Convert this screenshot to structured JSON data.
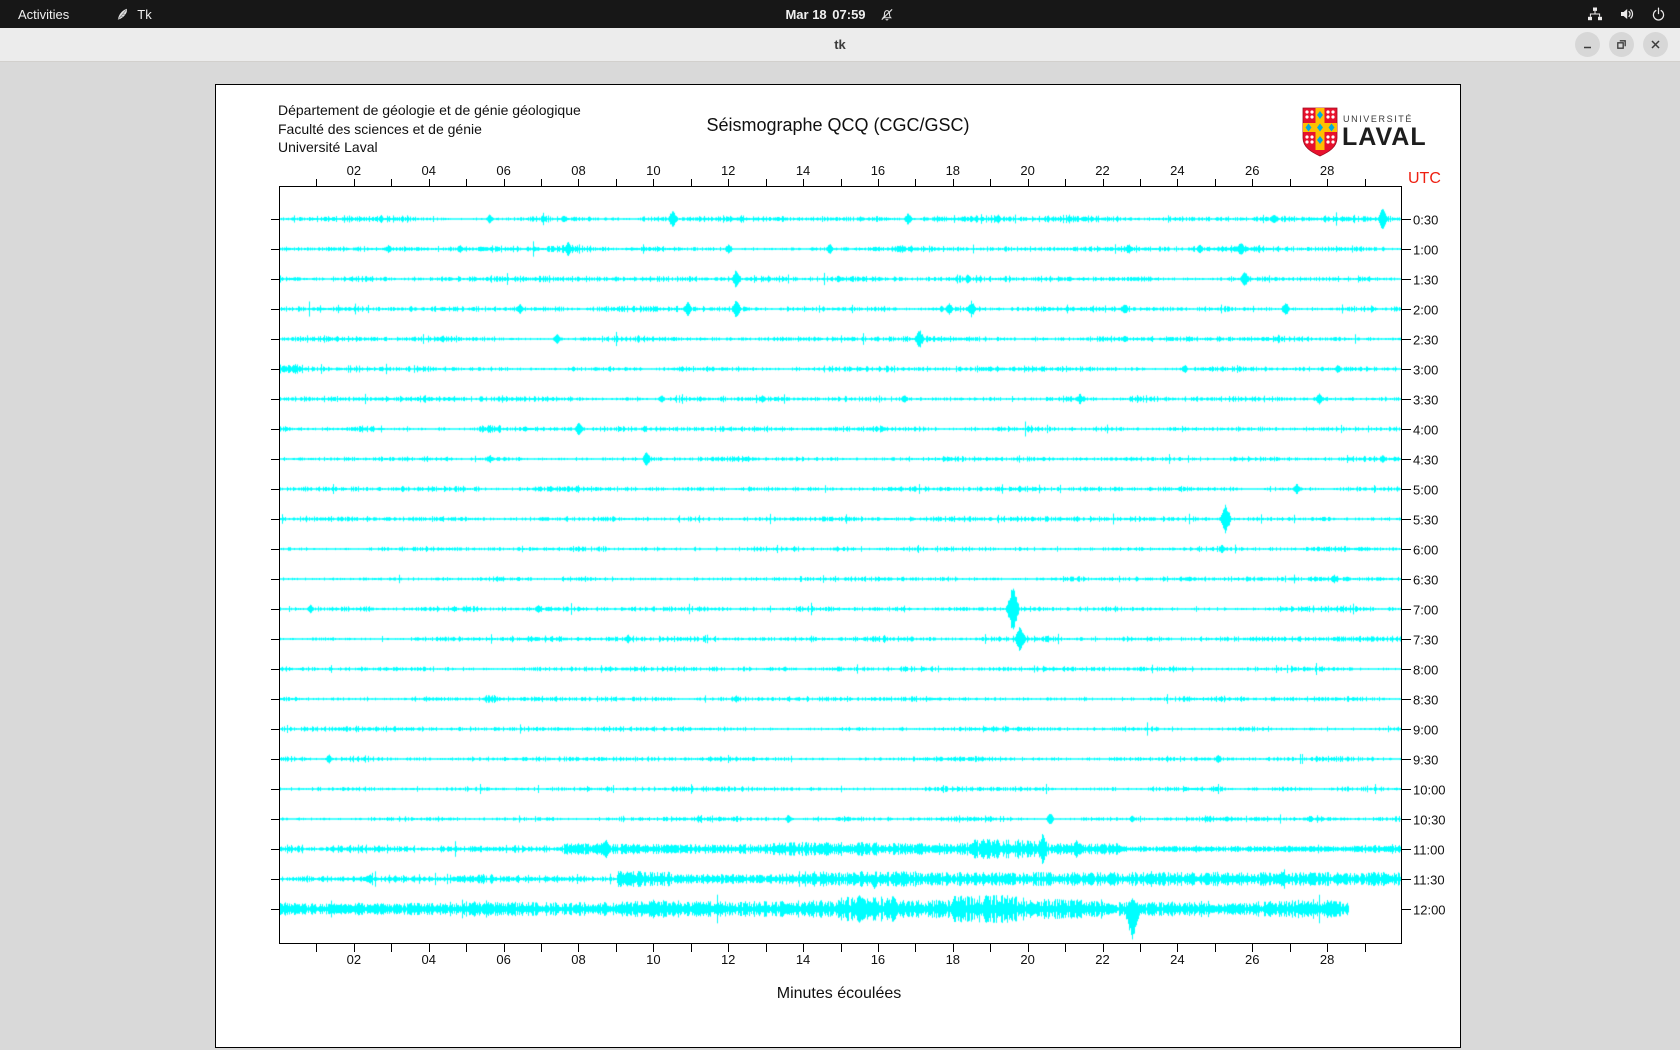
{
  "topbar": {
    "activities": "Activities",
    "app_name": "Tk",
    "clock_date": "Mar 18",
    "clock_time": "07:59"
  },
  "titlebar": {
    "title": "tk"
  },
  "header": {
    "line1": "Département de géologie et de génie géologique",
    "line2": "Faculté des sciences et de génie",
    "line3": "Université Laval",
    "title": "Séismographe QCQ (CGC/GSC)"
  },
  "logo": {
    "small": "UNIVERSITÉ",
    "large": "LAVAL"
  },
  "axis": {
    "utc_label": "UTC",
    "xlabel": "Minutes écoulées",
    "x_tick_labels": [
      "02",
      "04",
      "06",
      "08",
      "10",
      "12",
      "14",
      "16",
      "18",
      "20",
      "22",
      "24",
      "26",
      "28"
    ],
    "x_tick_minutes": [
      2,
      4,
      6,
      8,
      10,
      12,
      14,
      16,
      18,
      20,
      22,
      24,
      26,
      28
    ],
    "x_minor_step": 1,
    "y_labels": [
      "0:30",
      "1:00",
      "1:30",
      "2:00",
      "2:30",
      "3:00",
      "3:30",
      "4:00",
      "4:30",
      "5:00",
      "5:30",
      "6:00",
      "6:30",
      "7:00",
      "7:30",
      "8:00",
      "8:30",
      "9:00",
      "9:30",
      "10:00",
      "10:30",
      "11:00",
      "11:30",
      "12:00"
    ]
  },
  "colors": {
    "trace": "#00ffff",
    "utc_red": "#ee2012",
    "shield_red": "#e8112d",
    "shield_gold": "#ffbf00",
    "shield_blue": "#00a9e0"
  },
  "chart_data": {
    "type": "line",
    "subtype": "seismogram-helicorder",
    "title": "Séismographe QCQ (CGC/GSC)",
    "xlabel": "Minutes écoulées",
    "x_range_minutes": [
      0,
      30
    ],
    "row_interval_minutes": 30,
    "timezone_label": "UTC",
    "rows": [
      {
        "label": "0:30",
        "base": 1.8,
        "end": 30,
        "bursts": [],
        "spikes": [
          [
            5.6,
            5
          ],
          [
            10.5,
            10
          ],
          [
            16.8,
            7
          ],
          [
            19.2,
            5
          ],
          [
            26.6,
            6
          ],
          [
            29.5,
            12
          ]
        ]
      },
      {
        "label": "1:00",
        "base": 1.8,
        "end": 30,
        "bursts": [],
        "spikes": [
          [
            2.9,
            5
          ],
          [
            4.8,
            5
          ],
          [
            7.7,
            8
          ],
          [
            12.0,
            6
          ],
          [
            14.7,
            6
          ],
          [
            22.7,
            6
          ],
          [
            24.6,
            5
          ],
          [
            25.7,
            8
          ]
        ]
      },
      {
        "label": "1:30",
        "base": 1.6,
        "end": 30,
        "bursts": [],
        "spikes": [
          [
            12.2,
            10
          ],
          [
            18.4,
            5
          ],
          [
            25.8,
            9
          ]
        ]
      },
      {
        "label": "2:00",
        "base": 1.7,
        "end": 30,
        "bursts": [],
        "spikes": [
          [
            6.4,
            6
          ],
          [
            10.9,
            8
          ],
          [
            12.2,
            11
          ],
          [
            17.9,
            7
          ],
          [
            18.5,
            9
          ],
          [
            22.6,
            6
          ],
          [
            26.9,
            8
          ]
        ]
      },
      {
        "label": "2:30",
        "base": 1.7,
        "end": 30,
        "bursts": [],
        "spikes": [
          [
            7.4,
            6
          ],
          [
            17.1,
            11
          ],
          [
            22.6,
            5
          ]
        ]
      },
      {
        "label": "3:00",
        "base": 1.7,
        "end": 30,
        "bursts": [
          [
            0,
            0.6,
            5
          ]
        ],
        "spikes": [
          [
            24.2,
            5
          ],
          [
            28.3,
            5
          ]
        ]
      },
      {
        "label": "3:30",
        "base": 1.6,
        "end": 30,
        "bursts": [],
        "spikes": [
          [
            10.2,
            5
          ],
          [
            12.9,
            5
          ],
          [
            16.7,
            5
          ],
          [
            21.4,
            6
          ],
          [
            27.8,
            7
          ]
        ]
      },
      {
        "label": "4:00",
        "base": 1.6,
        "end": 30,
        "bursts": [
          [
            5.3,
            5.9,
            4
          ]
        ],
        "spikes": [
          [
            8.0,
            8
          ]
        ]
      },
      {
        "label": "4:30",
        "base": 1.6,
        "end": 30,
        "bursts": [],
        "spikes": [
          [
            5.6,
            5
          ],
          [
            9.8,
            8
          ],
          [
            29.5,
            5
          ]
        ]
      },
      {
        "label": "5:00",
        "base": 1.5,
        "end": 30,
        "bursts": [],
        "spikes": [
          [
            27.2,
            6
          ]
        ]
      },
      {
        "label": "5:30",
        "base": 1.5,
        "end": 30,
        "bursts": [],
        "spikes": [
          [
            25.3,
            16
          ]
        ]
      },
      {
        "label": "6:00",
        "base": 1.4,
        "end": 30,
        "bursts": [],
        "spikes": [
          [
            25.2,
            5
          ]
        ]
      },
      {
        "label": "6:30",
        "base": 1.5,
        "end": 30,
        "bursts": [],
        "spikes": [
          [
            28.2,
            5
          ]
        ]
      },
      {
        "label": "7:00",
        "base": 1.6,
        "end": 30,
        "bursts": [],
        "spikes": [
          [
            0.8,
            5
          ],
          [
            6.9,
            5
          ],
          [
            19.6,
            24
          ]
        ]
      },
      {
        "label": "7:30",
        "base": 1.6,
        "end": 30,
        "bursts": [],
        "spikes": [
          [
            9.3,
            5
          ],
          [
            19.8,
            15
          ]
        ]
      },
      {
        "label": "8:00",
        "base": 1.4,
        "end": 30,
        "bursts": [],
        "spikes": [
          [
            13.5,
            3
          ]
        ]
      },
      {
        "label": "8:30",
        "base": 1.5,
        "end": 30,
        "bursts": [
          [
            5.4,
            5.8,
            4
          ]
        ],
        "spikes": [
          [
            12.2,
            4
          ]
        ]
      },
      {
        "label": "9:00",
        "base": 1.4,
        "end": 30,
        "bursts": [],
        "spikes": []
      },
      {
        "label": "9:30",
        "base": 1.5,
        "end": 30,
        "bursts": [],
        "spikes": [
          [
            1.3,
            5
          ],
          [
            25.1,
            5
          ]
        ]
      },
      {
        "label": "10:00",
        "base": 1.4,
        "end": 30,
        "bursts": [],
        "spikes": []
      },
      {
        "label": "10:30",
        "base": 1.6,
        "end": 30,
        "bursts": [],
        "spikes": [
          [
            13.6,
            5
          ],
          [
            20.6,
            7
          ],
          [
            22.8,
            4
          ]
        ]
      },
      {
        "label": "11:00",
        "base": 2.2,
        "end": 30,
        "bursts": [
          [
            7.6,
            9.5,
            6
          ],
          [
            9.5,
            13,
            5
          ],
          [
            13,
            16,
            7
          ],
          [
            16,
            18.5,
            6
          ],
          [
            18.5,
            20.5,
            10
          ],
          [
            20.5,
            22.5,
            6
          ],
          [
            22.5,
            30,
            3
          ]
        ],
        "spikes": [
          [
            8.7,
            12
          ],
          [
            14.6,
            9
          ],
          [
            20.4,
            16
          ],
          [
            21.3,
            10
          ],
          [
            24.5,
            4
          ],
          [
            27,
            4
          ]
        ]
      },
      {
        "label": "11:30",
        "base": 2.6,
        "end": 30,
        "bursts": [
          [
            9,
            10.5,
            8
          ],
          [
            10.5,
            14,
            5
          ],
          [
            14,
            17.5,
            8
          ],
          [
            17.5,
            21,
            7
          ],
          [
            21,
            30,
            7
          ]
        ],
        "spikes": [
          [
            2.4,
            5
          ],
          [
            9.3,
            10
          ],
          [
            15.9,
            -12
          ],
          [
            16.5,
            9
          ],
          [
            19.5,
            8
          ],
          [
            23.3,
            9
          ],
          [
            26.8,
            8
          ],
          [
            28.3,
            8
          ],
          [
            29.3,
            7
          ]
        ]
      },
      {
        "label": "12:00",
        "base": 4.5,
        "end": 28.6,
        "bursts": [
          [
            0,
            5,
            6
          ],
          [
            5,
            9,
            7
          ],
          [
            9,
            13,
            8
          ],
          [
            13,
            15,
            9
          ],
          [
            15,
            16.5,
            13
          ],
          [
            16.5,
            18,
            9
          ],
          [
            18,
            19.8,
            14
          ],
          [
            19.8,
            22,
            10
          ],
          [
            22,
            24,
            7
          ],
          [
            24,
            26,
            6
          ],
          [
            26,
            28.6,
            8
          ]
        ],
        "spikes": [
          [
            2.1,
            8
          ],
          [
            15.5,
            16
          ],
          [
            18.9,
            18
          ],
          [
            22.8,
            -34
          ],
          [
            28.2,
            10
          ]
        ]
      }
    ]
  }
}
